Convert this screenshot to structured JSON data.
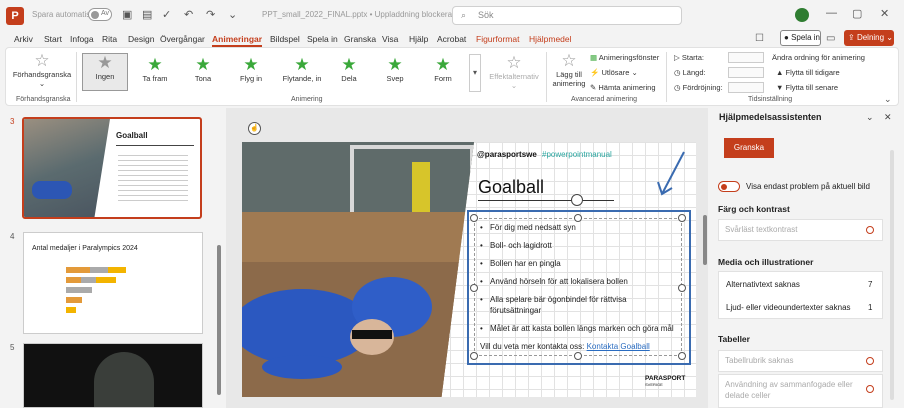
{
  "titlebar": {
    "autosave_label": "Spara automatiskt",
    "autosave_state": "Av",
    "file_name": "PPT_small_2022_FINAL.pptx • Uppladdning blockerad",
    "search_placeholder": "Sök",
    "window_controls": [
      "minimize-icon",
      "maximize-icon",
      "close-icon"
    ]
  },
  "tabs": {
    "items": [
      "Arkiv",
      "Start",
      "Infoga",
      "Rita",
      "Design",
      "Övergångar",
      "Animeringar",
      "Bildspel",
      "Spela in",
      "Granska",
      "Visa",
      "Hjälp",
      "Acrobat",
      "Figurformat",
      "Hjälpmedel"
    ],
    "active": "Animeringar",
    "play_label": "Spela in",
    "share_label": "Delning"
  },
  "ribbon": {
    "preview_label": "Förhandsgranska",
    "preview_group": "Förhandsgranska",
    "animations": [
      "Ingen",
      "Ta fram",
      "Tona",
      "Flyg in",
      "Flytande, in",
      "Dela",
      "Svep",
      "Form"
    ],
    "effect_options": "Effektalternativ",
    "animation_group": "Animering",
    "add_animation": "Lägg till animering",
    "animation_pane": "Animeringsfönster",
    "trigger": "Utlösare",
    "painter": "Hämta animering",
    "advanced_group": "Avancerad animering",
    "start_label": "Starta:",
    "duration_label": "Längd:",
    "delay_label": "Fördröjning:",
    "reorder_title": "Ändra ordning för animering",
    "move_earlier": "Flytta till tidigare",
    "move_later": "Flytta till senare",
    "timing_group": "Tidsinställning"
  },
  "thumbnails": [
    {
      "number": "3",
      "title": "Goalball",
      "selected": true
    },
    {
      "number": "4",
      "title": "Antal medaljer i Paralympics 2024",
      "selected": false
    },
    {
      "number": "5",
      "title": "",
      "selected": false
    }
  ],
  "slide": {
    "handle": "@parasportswe",
    "hashtag": "#powerpointmanual",
    "title": "Goalball",
    "bullets": [
      "För dig med nedsatt syn",
      "Boll- och lagidrott",
      "Bollen har en pingla",
      "Använd hörseln för att lokalisera bollen",
      "Alla spelare bär ögonbindel för rättvisa förutsättningar",
      "Målet är att kasta bollen längs marken och göra mål"
    ],
    "footer_text": "Vill du veta mer kontakta oss:",
    "footer_link": "Kontakta Goalball",
    "logo": "PARASPORT",
    "logo_sub": "SVERIGE"
  },
  "pane": {
    "title": "Hjälpmedelsassistenten",
    "review_button": "Granska",
    "toggle_label": "Visa endast problem på aktuell bild",
    "sections": [
      {
        "heading": "Färg och kontrast",
        "rows": [
          {
            "label": "Svårläst textkontrast",
            "count": "",
            "muted": true
          }
        ]
      },
      {
        "heading": "Media och illustrationer",
        "rows": [
          {
            "label": "Alternativtext saknas",
            "count": "7",
            "muted": false
          },
          {
            "label": "Ljud- eller videoundertexter saknas",
            "count": "1",
            "muted": false
          }
        ]
      },
      {
        "heading": "Tabeller",
        "rows": [
          {
            "label": "Tabellrubrik saknas",
            "count": "",
            "muted": true
          },
          {
            "label": "Användning av sammanfogade eller delade celler",
            "count": "",
            "muted": true
          }
        ]
      }
    ]
  },
  "colors": {
    "accent": "#c43e1c",
    "selection": "#3a6bb0",
    "green_star": "#3aa83a"
  }
}
